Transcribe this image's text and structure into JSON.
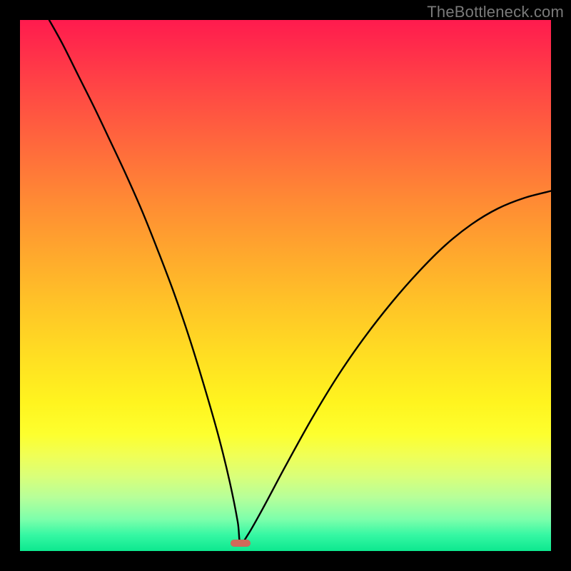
{
  "watermark": "TheBottleneck.com",
  "chart_data": {
    "type": "line",
    "title": "",
    "xlabel": "",
    "ylabel": "",
    "xlim": [
      0,
      1
    ],
    "ylim": [
      0,
      1
    ],
    "grid": false,
    "legend": null,
    "background": {
      "gradient_direction": "top-to-bottom",
      "stops": [
        {
          "pos": 0.0,
          "color": "#ff1b4e"
        },
        {
          "pos": 0.3,
          "color": "#ff7a38"
        },
        {
          "pos": 0.55,
          "color": "#ffc527"
        },
        {
          "pos": 0.75,
          "color": "#fdff2e"
        },
        {
          "pos": 0.9,
          "color": "#b6ff9a"
        },
        {
          "pos": 1.0,
          "color": "#0de88f"
        }
      ]
    },
    "marker": {
      "x": 0.415,
      "y": 0.015,
      "shape": "pill",
      "color": "#d06a5a"
    },
    "series": [
      {
        "name": "curve",
        "color": "#000000",
        "x": [
          0.055,
          0.08,
          0.11,
          0.14,
          0.17,
          0.2,
          0.23,
          0.26,
          0.29,
          0.32,
          0.35,
          0.375,
          0.395,
          0.41,
          0.415,
          0.43,
          0.46,
          0.5,
          0.55,
          0.6,
          0.65,
          0.7,
          0.75,
          0.8,
          0.85,
          0.9,
          0.95,
          1.0
        ],
        "y": [
          1.0,
          0.955,
          0.895,
          0.835,
          0.772,
          0.708,
          0.64,
          0.565,
          0.486,
          0.398,
          0.3,
          0.212,
          0.13,
          0.055,
          0.015,
          0.032,
          0.085,
          0.16,
          0.25,
          0.332,
          0.404,
          0.468,
          0.525,
          0.575,
          0.615,
          0.645,
          0.665,
          0.678
        ]
      }
    ]
  }
}
